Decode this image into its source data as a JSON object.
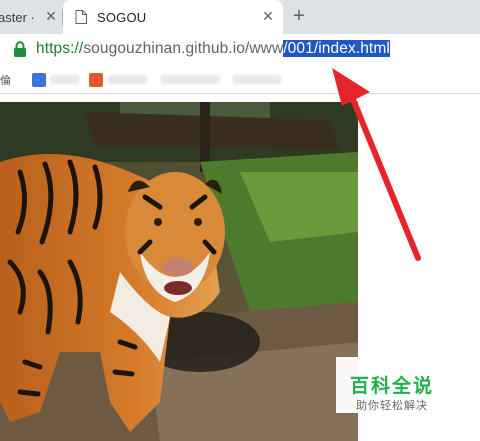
{
  "browser": {
    "tabs": [
      {
        "title": "aster ·",
        "active": false,
        "close_icon": "close-icon"
      },
      {
        "title": "SOGOU",
        "active": true,
        "icon": "document-icon",
        "close_icon": "close-icon"
      }
    ],
    "new_tab_icon": "plus-icon",
    "address_bar": {
      "lock_icon": "lock-icon",
      "scheme": "https://",
      "host": "sougouzhinan.github.io/www",
      "selected_path": "/001/index.html"
    },
    "bookmarks_bar": {
      "left_edge_text": "倫",
      "bookmark_colors": [
        "#3b74d8",
        "#e8582f"
      ]
    }
  },
  "content": {
    "image_subject": "tiger-photo"
  },
  "watermark": {
    "title": "百科全说",
    "subtitle": "助你轻松解决",
    "color": "#20b14c"
  },
  "annotation": {
    "arrow_color": "#e5252a",
    "arrow_icon": "red-arrow-icon"
  }
}
